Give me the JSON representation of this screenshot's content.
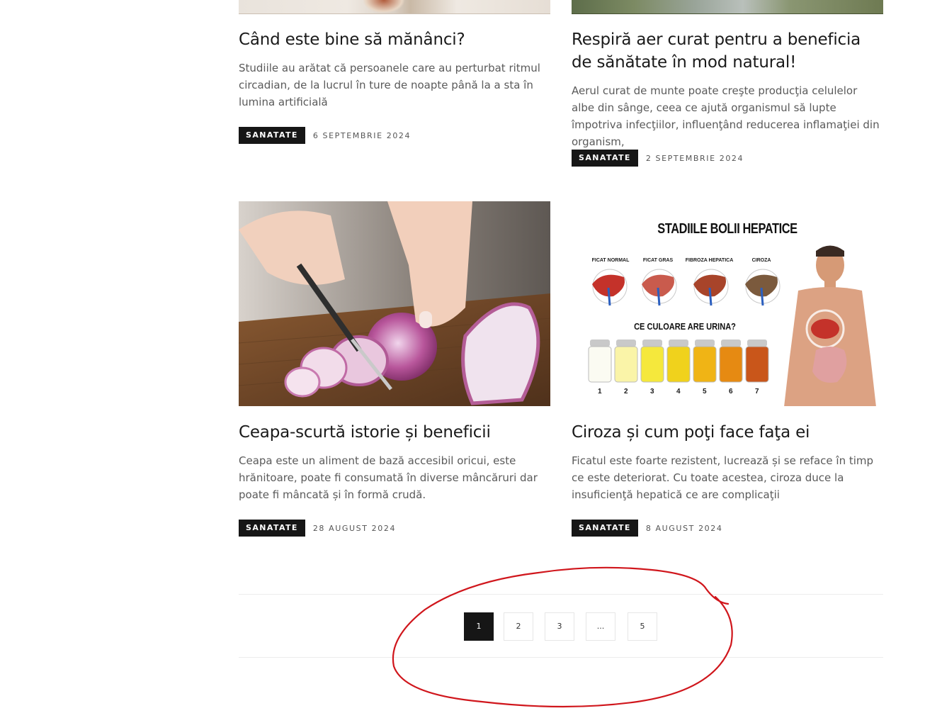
{
  "posts": [
    {
      "title": "Când este bine să mănânci?",
      "excerpt": "Studiile au arătat că persoanele care au perturbat ritmul circadian, de la lucrul în ture de noapte până la a sta în lumina artificială",
      "category": "SANATATE",
      "date": "6 SEPTEMBRIE 2024"
    },
    {
      "title": "Respiră aer curat pentru a beneficia de sănătate în mod natural!",
      "excerpt": "Aerul curat de munte poate creşte producţia celulelor albe din sânge, ceea ce ajută organismul să lupte împotriva infecţiilor, influenţând reducerea inflamaţiei din organism,",
      "category": "SANATATE",
      "date": "2 SEPTEMBRIE 2024"
    },
    {
      "title": "Ceapa-scurtă istorie și beneficii",
      "excerpt": "Ceapa este un aliment de bază accesibil oricui, este hrănitoare, poate fi consumată în diverse mâncăruri dar poate fi mâncată și în formă crudă.",
      "category": "SANATATE",
      "date": "28 AUGUST 2024"
    },
    {
      "title": "Ciroza și cum poţi face faţa ei",
      "excerpt": "Ficatul este foarte rezistent, lucrează și se reface în timp ce este deteriorat. Cu toate acestea, ciroza duce la insuficienţă hepatică ce are complicaţii",
      "category": "SANATATE",
      "date": "8 AUGUST 2024"
    }
  ],
  "infographic": {
    "title": "STADIILE BOLII HEPATICE",
    "stages": [
      "FICAT NORMAL",
      "FICAT GRAS",
      "FIBROZA HEPATICA",
      "CIROZA"
    ],
    "urine_title": "CE CULOARE ARE URINA?",
    "vials": [
      "1",
      "2",
      "3",
      "4",
      "5",
      "6",
      "7"
    ]
  },
  "pagination": {
    "pages": [
      "1",
      "2",
      "3",
      "...",
      "5"
    ],
    "current": "1"
  },
  "colors": {
    "badge_bg": "#161616",
    "annotation": "#d0161c"
  }
}
